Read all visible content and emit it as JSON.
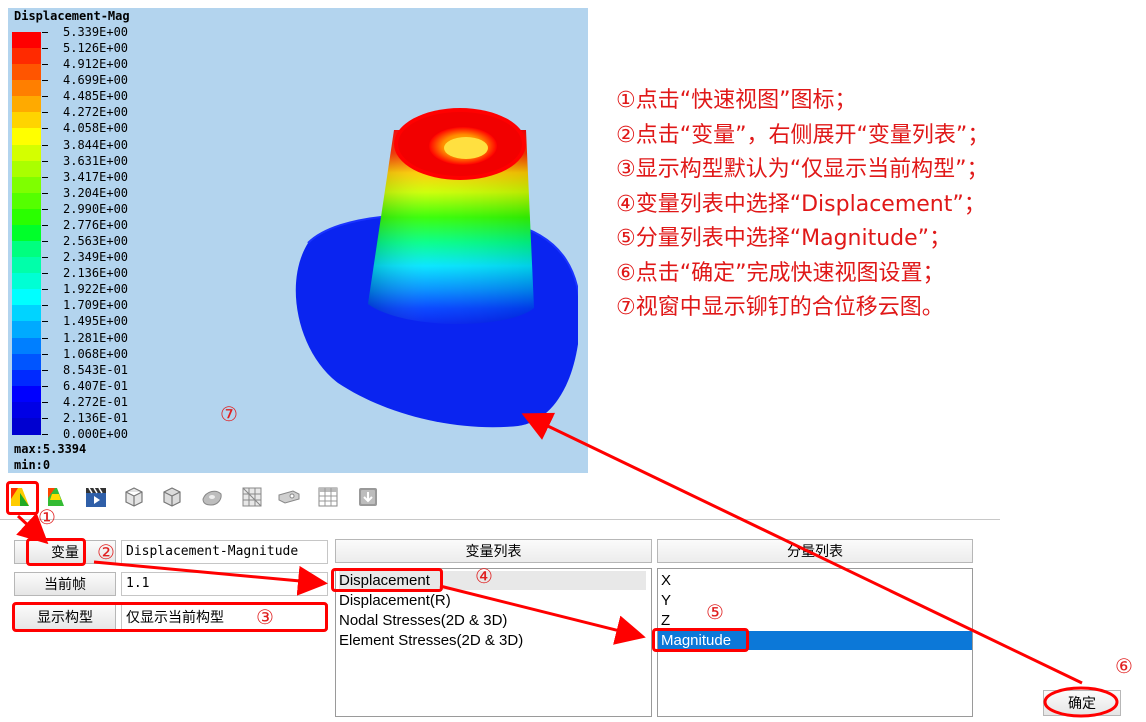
{
  "viewport": {
    "legend_title": "Displacement-Mag",
    "legend_values": [
      "5.339E+00",
      "5.126E+00",
      "4.912E+00",
      "4.699E+00",
      "4.485E+00",
      "4.272E+00",
      "4.058E+00",
      "3.844E+00",
      "3.631E+00",
      "3.417E+00",
      "3.204E+00",
      "2.990E+00",
      "2.776E+00",
      "2.563E+00",
      "2.349E+00",
      "2.136E+00",
      "1.922E+00",
      "1.709E+00",
      "1.495E+00",
      "1.281E+00",
      "1.068E+00",
      "8.543E-01",
      "6.407E-01",
      "4.272E-01",
      "2.136E-01",
      "0.000E+00"
    ],
    "legend_colors": [
      "#ff0000",
      "#ff2a00",
      "#ff5500",
      "#ff7f00",
      "#ffaa00",
      "#ffd400",
      "#ffff00",
      "#d4ff00",
      "#aaff00",
      "#7fff00",
      "#55ff00",
      "#2aff00",
      "#00ff2a",
      "#00ff7f",
      "#00ffaa",
      "#00ffd4",
      "#00ffff",
      "#00d4ff",
      "#00aaff",
      "#007fff",
      "#0055ff",
      "#002aff",
      "#0000ff",
      "#0000e6",
      "#0000d0"
    ],
    "max_label": "max:5.3394",
    "min_label": "min:0"
  },
  "toolbar": {
    "icons": [
      "quick-view-icon",
      "contour-icon",
      "animation-icon",
      "wireframe-cube-icon",
      "shaded-cube-icon",
      "surface-icon",
      "mesh-icon",
      "section-icon",
      "table-icon",
      "import-icon"
    ]
  },
  "form": {
    "variable_button": "变量",
    "variable_value": "Displacement-Magnitude",
    "frame_button": "当前帧",
    "frame_value": "1.1",
    "display_button": "显示构型",
    "display_value": "仅显示当前构型",
    "ok_button": "确定"
  },
  "variable_list": {
    "header": "变量列表",
    "items": [
      "Displacement",
      "Displacement(R)",
      "Nodal Stresses(2D & 3D)",
      "Element Stresses(2D & 3D)"
    ],
    "selected": "Displacement"
  },
  "component_list": {
    "header": "分量列表",
    "items": [
      "X",
      "Y",
      "Z",
      "Magnitude"
    ],
    "selected": "Magnitude"
  },
  "annotations": {
    "markers": [
      "①",
      "②",
      "③",
      "④",
      "⑤",
      "⑥",
      "⑦"
    ],
    "color": "#ff0000",
    "instructions": [
      "①点击“快速视图”图标；",
      "②点击“变量”，右侧展开“变量列表”；",
      "③显示构型默认为“仅显示当前构型”；",
      "④变量列表中选择“Displacement”；",
      "⑤分量列表中选择“Magnitude”；",
      "⑥点击“确定”完成快速视图设置；",
      "⑦视窗中显示铆钉的合位移云图。"
    ]
  }
}
